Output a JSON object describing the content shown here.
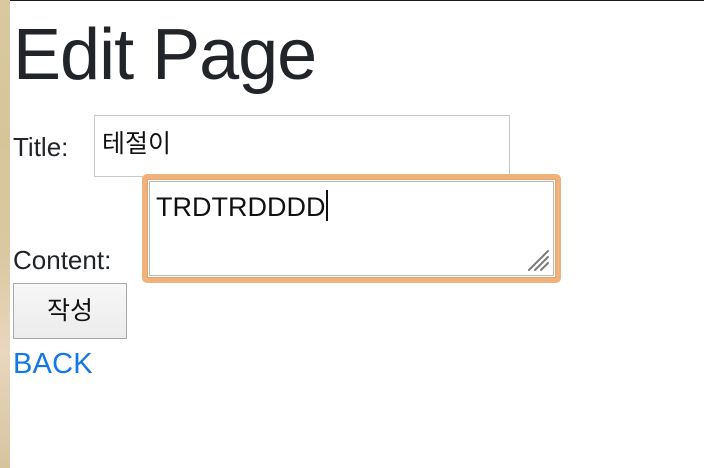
{
  "page": {
    "title": "Edit Page"
  },
  "form": {
    "title_label": "Title:",
    "title_value": "테절이",
    "content_label": "Content:",
    "content_value": "TRDTRDDDD",
    "submit_label": "작성"
  },
  "navigation": {
    "back_label": "BACK"
  },
  "colors": {
    "text": "#212529",
    "link": "#1178E5",
    "focus_border": "#EFB27B",
    "input_border": "#C8C8C8"
  },
  "icons": {
    "resize_handle": "resize-handle-icon"
  }
}
